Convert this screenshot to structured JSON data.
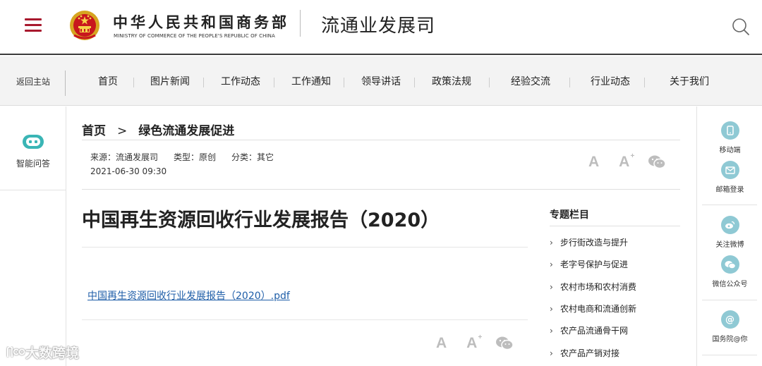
{
  "header": {
    "ministry_cn": "中华人民共和国商务部",
    "ministry_en": "MINISTRY OF COMMERCE OF THE PEOPLE'S REPUBLIC OF CHINA",
    "department": "流通业发展司"
  },
  "nav": {
    "home_label": "返回主站",
    "items": [
      {
        "label": "首页"
      },
      {
        "label": "图片新闻"
      },
      {
        "label": "工作动态"
      },
      {
        "label": "工作通知"
      },
      {
        "label": "领导讲话"
      },
      {
        "label": "政策法规"
      },
      {
        "label": "经验交流"
      },
      {
        "label": "行业动态"
      },
      {
        "label": "关于我们"
      }
    ]
  },
  "left_sidebar": {
    "assistant_label": "智能问答"
  },
  "breadcrumb": {
    "home": "首页",
    "separator": ">",
    "current": "绿色流通发展促进"
  },
  "meta": {
    "source": "来源：流通发展司",
    "type": "类型：原创",
    "category": "分类：其它",
    "date": "2021-06-30 09:30"
  },
  "article": {
    "title": "中国再生资源回收行业发展报告（2020）",
    "attachment": "中国再生资源回收行业发展报告（2020）.pdf"
  },
  "topics": {
    "heading": "专题栏目",
    "items": [
      {
        "label": "步行街改造与提升"
      },
      {
        "label": "老字号保护与促进"
      },
      {
        "label": "农村市场和农村消费"
      },
      {
        "label": "农村电商和流通创新"
      },
      {
        "label": "农产品流通骨干网"
      },
      {
        "label": "农产品产销对接"
      }
    ]
  },
  "right_sidebar": {
    "items": [
      {
        "label": "移动端",
        "icon": "mobile-icon"
      },
      {
        "label": "邮箱登录",
        "icon": "mail-icon"
      },
      {
        "label": "关注微博",
        "icon": "weibo-icon"
      },
      {
        "label": "微信公众号",
        "icon": "wechat-icon"
      },
      {
        "label": "国务院@你",
        "icon": "at-icon"
      }
    ]
  },
  "tools": {
    "font_decrease": "A",
    "font_increase": "A"
  },
  "watermark": "大数跨境",
  "colors": {
    "brand_red": "#a8192e",
    "link_blue": "#1f5ea8",
    "icon_teal": "#8fc9d4"
  }
}
